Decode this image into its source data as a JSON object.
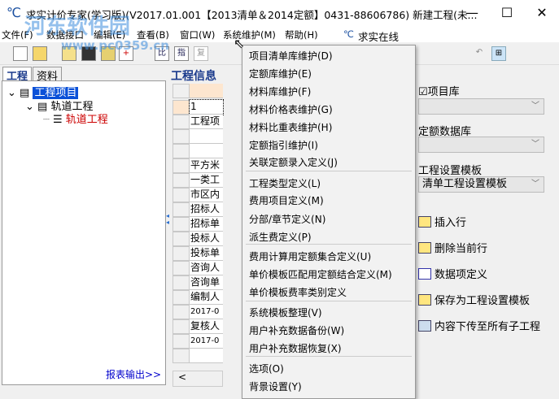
{
  "window": {
    "title": "求实计价专家(学习版)(V2017.01.001【2013清单＆2014定额】0431-88606786) 新建工程(未...",
    "minimize": "—",
    "maximize": "☐",
    "close": "✕"
  },
  "watermark": {
    "name": "河东软件园",
    "url": "www.pc0359.cn"
  },
  "menubar": [
    "文件(F)",
    "数据接口",
    "编辑(E)",
    "查看(B)",
    "窗口(W)",
    "系统维护(M)",
    "帮助(H)",
    "求实在线"
  ],
  "left": {
    "tabs": [
      "工程",
      "资料"
    ],
    "tree": [
      {
        "label": "工程项目",
        "selected": true
      },
      {
        "label": "轨道工程"
      },
      {
        "label": "轨道工程",
        "color": "#cc0000"
      }
    ],
    "report": "报表输出>>"
  },
  "grid": {
    "title": "工程信息",
    "cells": [
      "",
      "1",
      "工程项",
      "",
      "",
      "平方米",
      "一类工",
      "市区内",
      "招标人",
      "招标单",
      "投标人",
      "投标单",
      "咨询人",
      "咨询单",
      "编制人",
      "2017-0",
      "复核人",
      "2017-0",
      ""
    ],
    "scroll": "<"
  },
  "right": {
    "project_lib": "项目库",
    "quota_db": "定额数据库",
    "template_label": "工程设置模板",
    "template_value": "清单工程设置模板",
    "actions": [
      "插入行",
      "删除当前行",
      "数据项定义",
      "保存为工程设置模板",
      "内容下传至所有子工程"
    ]
  },
  "popup": {
    "items": [
      "项目清单库维护(D)",
      "定额库维护(E)",
      "材料库维护(F)",
      "材料价格表维护(G)",
      "材料比重表维护(H)",
      "定额指引维护(I)",
      "关联定额录入定义(J)",
      "工程类型定义(L)",
      "费用项目定义(M)",
      "分部/章节定义(N)",
      "派生费定义(P)",
      "费用计算用定额集合定义(U)",
      "单价模板匹配用定额结合定义(M)",
      "单价模板费率类别定义",
      "系统模板整理(V)",
      "用户补充数据备份(W)",
      "用户补充数据恢复(X)",
      "选项(O)",
      "背景设置(Y)"
    ]
  }
}
